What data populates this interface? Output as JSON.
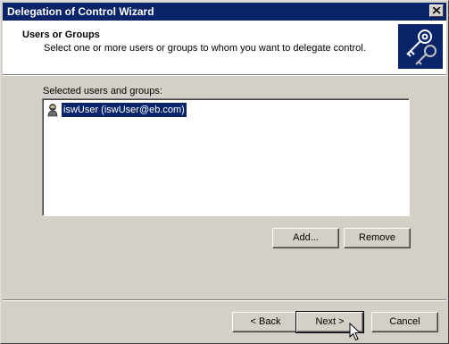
{
  "window": {
    "title": "Delegation of Control Wizard"
  },
  "header": {
    "title": "Users or Groups",
    "subtitle": "Select one or more users or groups to whom you want to delegate control.",
    "icon": "keys-icon"
  },
  "list": {
    "label": "Selected users and groups:",
    "items": [
      {
        "text": "iswUser (iswUser@eb.com)",
        "icon": "user-icon",
        "selected": true
      }
    ]
  },
  "buttons": {
    "add": "Add...",
    "remove": "Remove",
    "back": "< Back",
    "next": "Next >",
    "cancel": "Cancel"
  },
  "colors": {
    "titlebar": "#0a246a",
    "face": "#d4d0c8",
    "selection": "#0a246a"
  }
}
